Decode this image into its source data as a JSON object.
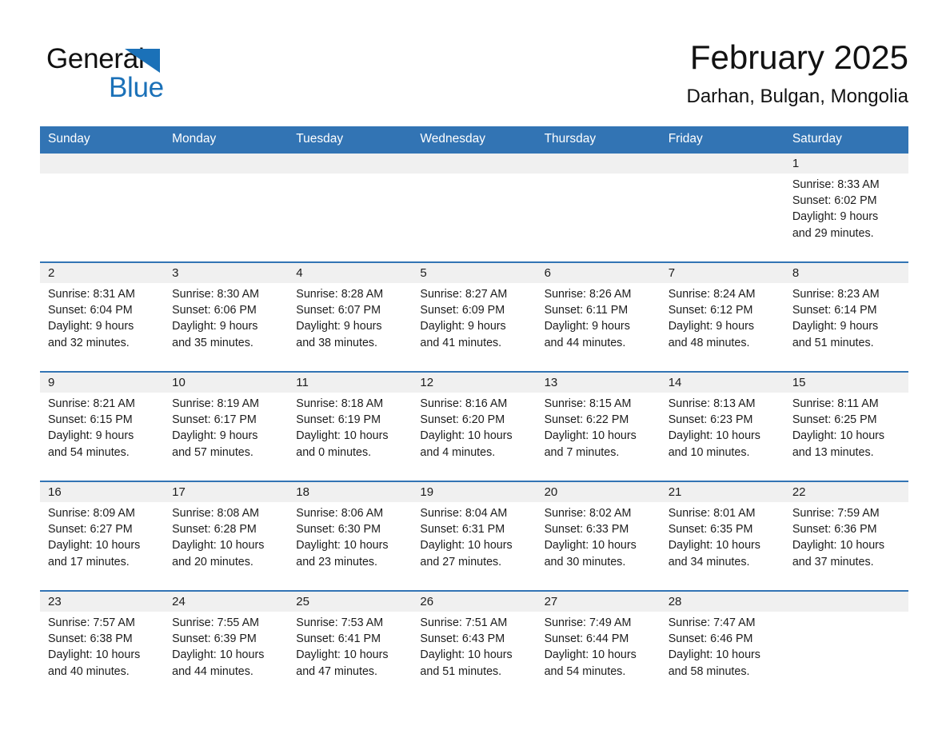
{
  "brand": {
    "line1": "General",
    "line2": "Blue",
    "triangle_icon": "blue-triangle-logo-mark",
    "accent_color": "#1b71b8"
  },
  "header": {
    "title": "February 2025",
    "subtitle": "Darhan, Bulgan, Mongolia"
  },
  "theme": {
    "header_blue": "#3274b4",
    "day_band_gray": "#f0f0f0",
    "text": "#1c1c1c"
  },
  "weekdays": [
    "Sunday",
    "Monday",
    "Tuesday",
    "Wednesday",
    "Thursday",
    "Friday",
    "Saturday"
  ],
  "weeks": [
    [
      {
        "day": "",
        "sunrise": "",
        "sunset": "",
        "daylight1": "",
        "daylight2": ""
      },
      {
        "day": "",
        "sunrise": "",
        "sunset": "",
        "daylight1": "",
        "daylight2": ""
      },
      {
        "day": "",
        "sunrise": "",
        "sunset": "",
        "daylight1": "",
        "daylight2": ""
      },
      {
        "day": "",
        "sunrise": "",
        "sunset": "",
        "daylight1": "",
        "daylight2": ""
      },
      {
        "day": "",
        "sunrise": "",
        "sunset": "",
        "daylight1": "",
        "daylight2": ""
      },
      {
        "day": "",
        "sunrise": "",
        "sunset": "",
        "daylight1": "",
        "daylight2": ""
      },
      {
        "day": "1",
        "sunrise": "Sunrise: 8:33 AM",
        "sunset": "Sunset: 6:02 PM",
        "daylight1": "Daylight: 9 hours",
        "daylight2": "and 29 minutes."
      }
    ],
    [
      {
        "day": "2",
        "sunrise": "Sunrise: 8:31 AM",
        "sunset": "Sunset: 6:04 PM",
        "daylight1": "Daylight: 9 hours",
        "daylight2": "and 32 minutes."
      },
      {
        "day": "3",
        "sunrise": "Sunrise: 8:30 AM",
        "sunset": "Sunset: 6:06 PM",
        "daylight1": "Daylight: 9 hours",
        "daylight2": "and 35 minutes."
      },
      {
        "day": "4",
        "sunrise": "Sunrise: 8:28 AM",
        "sunset": "Sunset: 6:07 PM",
        "daylight1": "Daylight: 9 hours",
        "daylight2": "and 38 minutes."
      },
      {
        "day": "5",
        "sunrise": "Sunrise: 8:27 AM",
        "sunset": "Sunset: 6:09 PM",
        "daylight1": "Daylight: 9 hours",
        "daylight2": "and 41 minutes."
      },
      {
        "day": "6",
        "sunrise": "Sunrise: 8:26 AM",
        "sunset": "Sunset: 6:11 PM",
        "daylight1": "Daylight: 9 hours",
        "daylight2": "and 44 minutes."
      },
      {
        "day": "7",
        "sunrise": "Sunrise: 8:24 AM",
        "sunset": "Sunset: 6:12 PM",
        "daylight1": "Daylight: 9 hours",
        "daylight2": "and 48 minutes."
      },
      {
        "day": "8",
        "sunrise": "Sunrise: 8:23 AM",
        "sunset": "Sunset: 6:14 PM",
        "daylight1": "Daylight: 9 hours",
        "daylight2": "and 51 minutes."
      }
    ],
    [
      {
        "day": "9",
        "sunrise": "Sunrise: 8:21 AM",
        "sunset": "Sunset: 6:15 PM",
        "daylight1": "Daylight: 9 hours",
        "daylight2": "and 54 minutes."
      },
      {
        "day": "10",
        "sunrise": "Sunrise: 8:19 AM",
        "sunset": "Sunset: 6:17 PM",
        "daylight1": "Daylight: 9 hours",
        "daylight2": "and 57 minutes."
      },
      {
        "day": "11",
        "sunrise": "Sunrise: 8:18 AM",
        "sunset": "Sunset: 6:19 PM",
        "daylight1": "Daylight: 10 hours",
        "daylight2": "and 0 minutes."
      },
      {
        "day": "12",
        "sunrise": "Sunrise: 8:16 AM",
        "sunset": "Sunset: 6:20 PM",
        "daylight1": "Daylight: 10 hours",
        "daylight2": "and 4 minutes."
      },
      {
        "day": "13",
        "sunrise": "Sunrise: 8:15 AM",
        "sunset": "Sunset: 6:22 PM",
        "daylight1": "Daylight: 10 hours",
        "daylight2": "and 7 minutes."
      },
      {
        "day": "14",
        "sunrise": "Sunrise: 8:13 AM",
        "sunset": "Sunset: 6:23 PM",
        "daylight1": "Daylight: 10 hours",
        "daylight2": "and 10 minutes."
      },
      {
        "day": "15",
        "sunrise": "Sunrise: 8:11 AM",
        "sunset": "Sunset: 6:25 PM",
        "daylight1": "Daylight: 10 hours",
        "daylight2": "and 13 minutes."
      }
    ],
    [
      {
        "day": "16",
        "sunrise": "Sunrise: 8:09 AM",
        "sunset": "Sunset: 6:27 PM",
        "daylight1": "Daylight: 10 hours",
        "daylight2": "and 17 minutes."
      },
      {
        "day": "17",
        "sunrise": "Sunrise: 8:08 AM",
        "sunset": "Sunset: 6:28 PM",
        "daylight1": "Daylight: 10 hours",
        "daylight2": "and 20 minutes."
      },
      {
        "day": "18",
        "sunrise": "Sunrise: 8:06 AM",
        "sunset": "Sunset: 6:30 PM",
        "daylight1": "Daylight: 10 hours",
        "daylight2": "and 23 minutes."
      },
      {
        "day": "19",
        "sunrise": "Sunrise: 8:04 AM",
        "sunset": "Sunset: 6:31 PM",
        "daylight1": "Daylight: 10 hours",
        "daylight2": "and 27 minutes."
      },
      {
        "day": "20",
        "sunrise": "Sunrise: 8:02 AM",
        "sunset": "Sunset: 6:33 PM",
        "daylight1": "Daylight: 10 hours",
        "daylight2": "and 30 minutes."
      },
      {
        "day": "21",
        "sunrise": "Sunrise: 8:01 AM",
        "sunset": "Sunset: 6:35 PM",
        "daylight1": "Daylight: 10 hours",
        "daylight2": "and 34 minutes."
      },
      {
        "day": "22",
        "sunrise": "Sunrise: 7:59 AM",
        "sunset": "Sunset: 6:36 PM",
        "daylight1": "Daylight: 10 hours",
        "daylight2": "and 37 minutes."
      }
    ],
    [
      {
        "day": "23",
        "sunrise": "Sunrise: 7:57 AM",
        "sunset": "Sunset: 6:38 PM",
        "daylight1": "Daylight: 10 hours",
        "daylight2": "and 40 minutes."
      },
      {
        "day": "24",
        "sunrise": "Sunrise: 7:55 AM",
        "sunset": "Sunset: 6:39 PM",
        "daylight1": "Daylight: 10 hours",
        "daylight2": "and 44 minutes."
      },
      {
        "day": "25",
        "sunrise": "Sunrise: 7:53 AM",
        "sunset": "Sunset: 6:41 PM",
        "daylight1": "Daylight: 10 hours",
        "daylight2": "and 47 minutes."
      },
      {
        "day": "26",
        "sunrise": "Sunrise: 7:51 AM",
        "sunset": "Sunset: 6:43 PM",
        "daylight1": "Daylight: 10 hours",
        "daylight2": "and 51 minutes."
      },
      {
        "day": "27",
        "sunrise": "Sunrise: 7:49 AM",
        "sunset": "Sunset: 6:44 PM",
        "daylight1": "Daylight: 10 hours",
        "daylight2": "and 54 minutes."
      },
      {
        "day": "28",
        "sunrise": "Sunrise: 7:47 AM",
        "sunset": "Sunset: 6:46 PM",
        "daylight1": "Daylight: 10 hours",
        "daylight2": "and 58 minutes."
      },
      {
        "day": "",
        "sunrise": "",
        "sunset": "",
        "daylight1": "",
        "daylight2": ""
      }
    ]
  ]
}
